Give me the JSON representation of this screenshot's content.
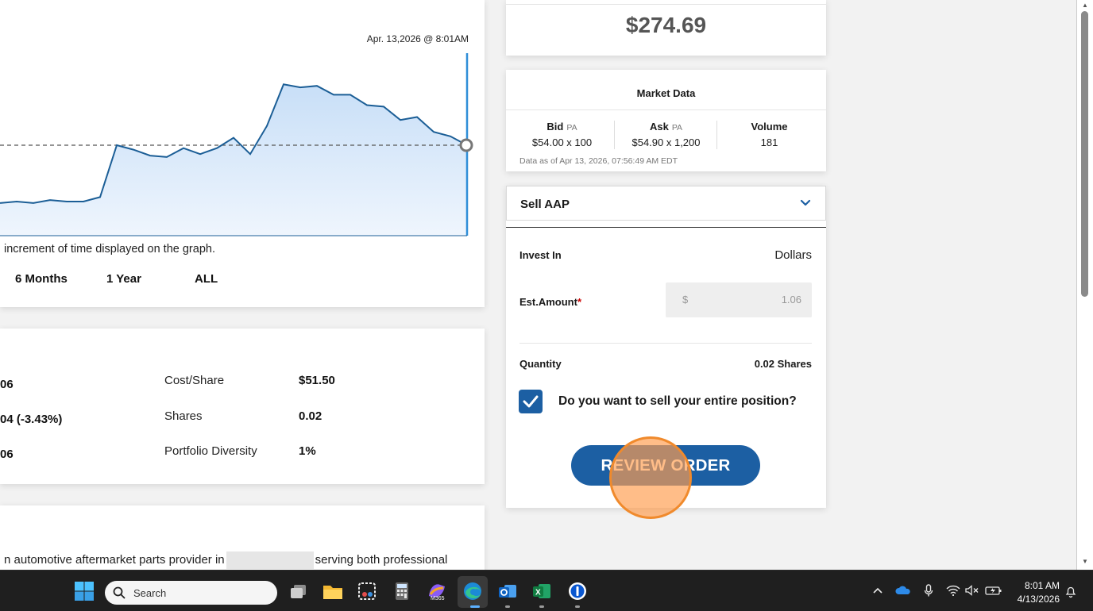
{
  "chart": {
    "timestamp": "Apr. 13,2026 @ 8:01AM",
    "note": "increment of time displayed on the graph.",
    "ranges": [
      "6 Months",
      "1 Year",
      "ALL"
    ],
    "colors": {
      "line": "#1b5e96",
      "fill": "#cfe4fa",
      "baseline": "#555555"
    }
  },
  "chart_data": {
    "type": "area",
    "title": "",
    "xlabel": "",
    "ylabel": "",
    "series": [
      {
        "values": [
          52.6,
          52.7,
          52.6,
          52.8,
          52.7,
          52.7,
          53.0,
          56.5,
          56.2,
          55.8,
          55.7,
          56.3,
          55.9,
          56.3,
          57.0,
          55.9,
          57.8,
          60.6,
          60.4,
          60.5,
          59.9,
          59.9,
          59.2,
          59.1,
          58.2,
          58.4,
          57.4,
          57.1,
          56.5
        ]
      }
    ],
    "baseline": 56.5,
    "grid": false,
    "legend": "none"
  },
  "position": {
    "left_values": [
      "06",
      "04 (-3.43%)",
      "06"
    ],
    "cost_share_label": "Cost/Share",
    "cost_share_value": "$51.50",
    "shares_label": "Shares",
    "shares_value": "0.02",
    "diversity_label": "Portfolio Diversity",
    "diversity_value": "1%"
  },
  "about": {
    "text_before": "n automotive aftermarket parts provider in",
    "text_after": "serving both professional"
  },
  "price": {
    "value": "$274.69"
  },
  "market": {
    "title": "Market Data",
    "bid_label": "Bid",
    "bid_exchange": "PA",
    "bid_value": "$54.00 x 100",
    "ask_label": "Ask",
    "ask_exchange": "PA",
    "ask_value": "$54.90 x 1,200",
    "volume_label": "Volume",
    "volume_value": "181",
    "as_of": "Data as of Apr 13, 2026, 07:56:49 AM EDT"
  },
  "trade": {
    "action": "Sell AAP",
    "invest_in_label": "Invest In",
    "invest_in_value": "Dollars",
    "amount_label": "Est.Amount",
    "amount_required": "*",
    "amount_prefix": "$",
    "amount_value": "1.06",
    "quantity_label": "Quantity",
    "quantity_value": "0.02 Shares",
    "sell_all_question": "Do you want to sell your entire position?",
    "sell_all_checked": true,
    "review_button": "REVIEW ORDER",
    "accent": "#1c5fa3"
  },
  "taskbar": {
    "search_placeholder": "Search",
    "apps": [
      "windows-start-icon",
      "task-view-icon",
      "file-explorer-icon",
      "snipping-tool-icon",
      "calculator-icon",
      "m365-copilot-icon",
      "edge-browser-icon",
      "outlook-icon",
      "excel-icon",
      "1password-icon"
    ],
    "m365_label": "M365",
    "clock_time": "8:01 AM",
    "clock_date": "4/13/2026"
  }
}
